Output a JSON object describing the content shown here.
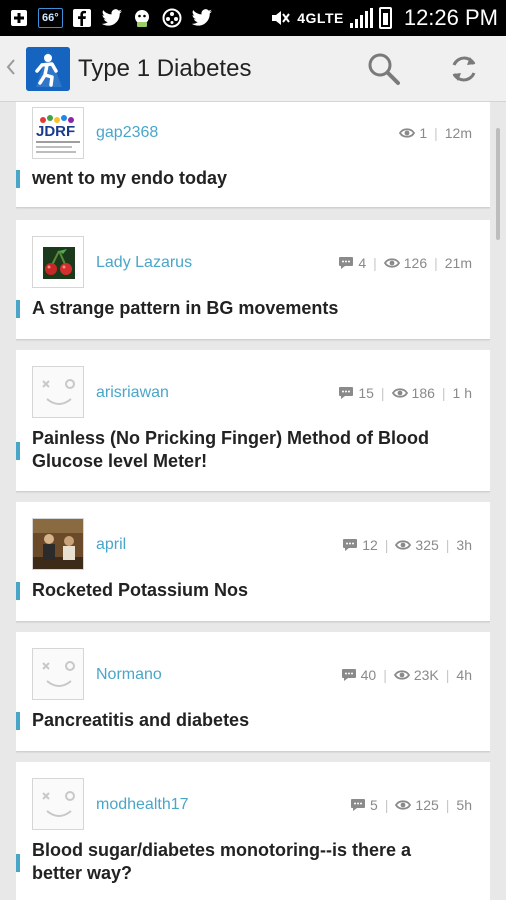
{
  "status_bar": {
    "notification_temp": "66°",
    "network": "4GLTE",
    "time": "12:26 PM"
  },
  "app_bar": {
    "title": "Type 1 Diabetes",
    "logo_icon": "person-logo-icon",
    "actions": [
      "search-icon",
      "refresh-icon"
    ]
  },
  "accent_color": "#4aa6c9",
  "posts": [
    {
      "username": "gap2368",
      "avatar": "jdrf-logo",
      "comments": null,
      "views": "1",
      "time": "12m",
      "title": "went to my endo today"
    },
    {
      "username": "Lady Lazarus",
      "avatar": "cherries",
      "comments": "4",
      "views": "126",
      "time": "21m",
      "title": "A strange pattern in BG movements"
    },
    {
      "username": "arisriawan",
      "avatar": "default-face",
      "comments": "15",
      "views": "186",
      "time": "1 h",
      "title": "Painless (No Pricking Finger) Method of Blood Glucose level Meter!"
    },
    {
      "username": "april",
      "avatar": "photo",
      "comments": "12",
      "views": "325",
      "time": "3h",
      "title": "Rocketed Potassium Nos"
    },
    {
      "username": "Normano",
      "avatar": "default-face",
      "comments": "40",
      "views": "23K",
      "time": "4h",
      "title": "Pancreatitis and diabetes"
    },
    {
      "username": "modhealth17",
      "avatar": "default-face",
      "comments": "5",
      "views": "125",
      "time": "5h",
      "title": "Blood sugar/diabetes monotoring--is there a better way?"
    }
  ]
}
